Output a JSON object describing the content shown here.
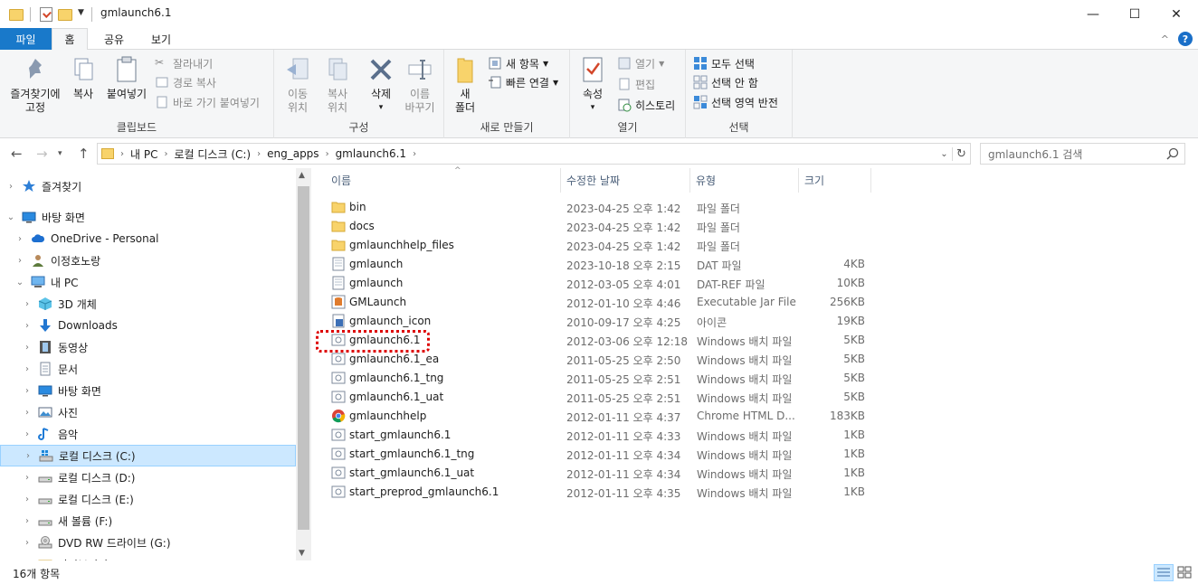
{
  "window": {
    "title": "gmlaunch6.1",
    "minimize": "—",
    "maximize": "☐",
    "close": "✕"
  },
  "ribbon_tabs": {
    "file": "파일",
    "home": "홈",
    "share": "공유",
    "view": "보기",
    "collapse": "^"
  },
  "ribbon": {
    "clipboard": {
      "pin_line1": "즐겨찾기에",
      "pin_line2": "고정",
      "copy": "복사",
      "paste": "붙여넣기",
      "cut": "잘라내기",
      "copy_path": "경로 복사",
      "paste_shortcut": "바로 가기 붙여넣기",
      "label": "클립보드"
    },
    "organize": {
      "move_line1": "이동",
      "move_line2": "위치",
      "copyto_line1": "복사",
      "copyto_line2": "위치",
      "delete": "삭제",
      "rename_line1": "이름",
      "rename_line2": "바꾸기",
      "label": "구성"
    },
    "new": {
      "folder_line1": "새",
      "folder_line2": "폴더",
      "new_item": "새 항목",
      "easy_access": "빠른 연결",
      "label": "새로 만들기"
    },
    "open": {
      "properties": "속성",
      "open": "열기",
      "edit": "편집",
      "history": "히스토리",
      "label": "열기"
    },
    "select": {
      "select_all": "모두 선택",
      "select_none": "선택 안 함",
      "invert": "선택 영역 반전",
      "label": "선택"
    }
  },
  "address": {
    "crumbs": [
      "내 PC",
      "로컬 디스크 (C:)",
      "eng_apps",
      "gmlaunch6.1"
    ],
    "search_placeholder": "gmlaunch6.1 검색"
  },
  "nav_tree": [
    {
      "label": "즐겨찾기",
      "icon": "star-icon",
      "expanded": false
    },
    {
      "label": "바탕 화면",
      "icon": "desktop-icon",
      "expanded": true
    },
    {
      "label": "OneDrive - Personal",
      "icon": "cloud-icon",
      "expanded": false
    },
    {
      "label": "이정호노랑",
      "icon": "user-icon",
      "expanded": false
    },
    {
      "label": "내 PC",
      "icon": "pc-icon",
      "expanded": true
    },
    {
      "label": "3D 개체",
      "icon": "3d-objects-icon",
      "expanded": false
    },
    {
      "label": "Downloads",
      "icon": "download-arrow-icon",
      "expanded": false
    },
    {
      "label": "동영상",
      "icon": "video-icon",
      "expanded": false
    },
    {
      "label": "문서",
      "icon": "document-icon",
      "expanded": false
    },
    {
      "label": "바탕 화면",
      "icon": "desktop-icon",
      "expanded": false
    },
    {
      "label": "사진",
      "icon": "pictures-icon",
      "expanded": false
    },
    {
      "label": "음악",
      "icon": "music-icon",
      "expanded": false
    },
    {
      "label": "로컬 디스크 (C:)",
      "icon": "windows-drive-icon",
      "expanded": false
    },
    {
      "label": "로컬 디스크 (D:)",
      "icon": "drive-icon",
      "expanded": false
    },
    {
      "label": "로컬 디스크 (E:)",
      "icon": "drive-icon",
      "expanded": false
    },
    {
      "label": "새 볼륨 (F:)",
      "icon": "drive-icon",
      "expanded": false
    },
    {
      "label": "DVD RW 드라이브 (G:)",
      "icon": "dvd-drive-icon",
      "expanded": false
    },
    {
      "label": "라이브러리",
      "icon": "library-icon",
      "expanded": false
    }
  ],
  "columns": {
    "name": "이름",
    "date": "수정한 날짜",
    "type": "유형",
    "size": "크기"
  },
  "files": [
    {
      "name": "bin",
      "date": "2023-04-25 오후 1:42",
      "type": "파일 폴더",
      "size": "",
      "icon": "folder-icon"
    },
    {
      "name": "docs",
      "date": "2023-04-25 오후 1:42",
      "type": "파일 폴더",
      "size": "",
      "icon": "folder-icon"
    },
    {
      "name": "gmlaunchhelp_files",
      "date": "2023-04-25 오후 1:42",
      "type": "파일 폴더",
      "size": "",
      "icon": "folder-icon"
    },
    {
      "name": "gmlaunch",
      "date": "2023-10-18 오후 2:15",
      "type": "DAT 파일",
      "size": "4KB",
      "icon": "generic-file-icon"
    },
    {
      "name": "gmlaunch",
      "date": "2012-03-05 오후 4:01",
      "type": "DAT-REF 파일",
      "size": "10KB",
      "icon": "generic-file-icon"
    },
    {
      "name": "GMLaunch",
      "date": "2012-01-10 오후 4:46",
      "type": "Executable Jar File",
      "size": "256KB",
      "icon": "jar-file-icon"
    },
    {
      "name": "gmlaunch_icon",
      "date": "2010-09-17 오후 4:25",
      "type": "아이콘",
      "size": "19KB",
      "icon": "ico-file-icon"
    },
    {
      "name": "gmlaunch6.1",
      "date": "2012-03-06 오후 12:18",
      "type": "Windows 배치 파일",
      "size": "5KB",
      "icon": "batch-file-icon"
    },
    {
      "name": "gmlaunch6.1_ea",
      "date": "2011-05-25 오후 2:50",
      "type": "Windows 배치 파일",
      "size": "5KB",
      "icon": "batch-file-icon"
    },
    {
      "name": "gmlaunch6.1_tng",
      "date": "2011-05-25 오후 2:51",
      "type": "Windows 배치 파일",
      "size": "5KB",
      "icon": "batch-file-icon"
    },
    {
      "name": "gmlaunch6.1_uat",
      "date": "2011-05-25 오후 2:51",
      "type": "Windows 배치 파일",
      "size": "5KB",
      "icon": "batch-file-icon"
    },
    {
      "name": "gmlaunchhelp",
      "date": "2012-01-11 오후 4:37",
      "type": "Chrome HTML D...",
      "size": "183KB",
      "icon": "chrome-icon"
    },
    {
      "name": "start_gmlaunch6.1",
      "date": "2012-01-11 오후 4:33",
      "type": "Windows 배치 파일",
      "size": "1KB",
      "icon": "batch-file-icon"
    },
    {
      "name": "start_gmlaunch6.1_tng",
      "date": "2012-01-11 오후 4:34",
      "type": "Windows 배치 파일",
      "size": "1KB",
      "icon": "batch-file-icon"
    },
    {
      "name": "start_gmlaunch6.1_uat",
      "date": "2012-01-11 오후 4:34",
      "type": "Windows 배치 파일",
      "size": "1KB",
      "icon": "batch-file-icon"
    },
    {
      "name": "start_preprod_gmlaunch6.1",
      "date": "2012-01-11 오후 4:35",
      "type": "Windows 배치 파일",
      "size": "1KB",
      "icon": "batch-file-icon"
    }
  ],
  "status": {
    "item_count": "16개 항목"
  },
  "colors": {
    "accent": "#1979ca",
    "selection": "#cce8ff",
    "highlight_box": "#dd0000",
    "folder": "#f8d36b"
  }
}
